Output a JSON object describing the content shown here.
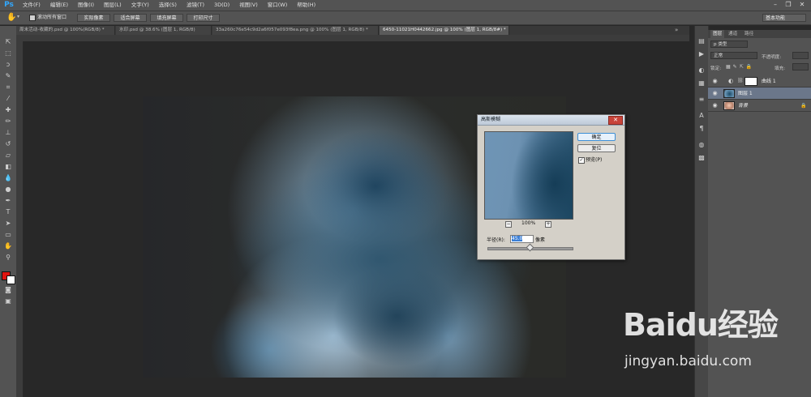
{
  "app": {
    "logo": "Ps"
  },
  "menu": [
    "文件(F)",
    "编辑(E)",
    "图像(I)",
    "图层(L)",
    "文字(Y)",
    "选择(S)",
    "滤镜(T)",
    "3D(D)",
    "视图(V)",
    "窗口(W)",
    "帮助(H)"
  ],
  "window_controls": {
    "minimize": "–",
    "restore": "❐",
    "close": "✕"
  },
  "options": {
    "scroll_all": "滚动所有窗口",
    "actual_pixels": "实际像素",
    "fit_screen": "适合屏幕",
    "fill_screen": "填充屏幕",
    "print_size": "打印尺寸",
    "workspace": "基本功能"
  },
  "tabs": [
    {
      "label": "周末活动-收藏的.psd @ 100%(RGB/8) *"
    },
    {
      "label": "水印.psd @ 38.6% (图层 1, RGB/8)"
    },
    {
      "label": "33a260c76e54c9d2a6f057e093f8ea.png @ 100% (图层 1, RGB/8) *"
    },
    {
      "label": "6450-11021H0442662.jpg @ 100% (图层 1, RGB/8#) *"
    }
  ],
  "dialog": {
    "title": "高斯模糊",
    "ok": "确定",
    "reset": "复位",
    "preview_label": "预览(P)",
    "zoom": "100%",
    "zoom_out": "−",
    "zoom_in": "+",
    "radius_label": "半径(R):",
    "radius_value": "45.0",
    "unit": "像素",
    "close": "✕"
  },
  "panel": {
    "tabs": [
      "图层",
      "通道",
      "路径"
    ],
    "kind_filter": "p 类型",
    "blend_mode": "正常",
    "opacity_label": "不透明度:",
    "lock_label": "锁定:",
    "fill_label": "填充:",
    "layers": [
      {
        "name": "曲线 1",
        "selected": false
      },
      {
        "name": "图层 1",
        "selected": true
      },
      {
        "name": "背景",
        "selected": false
      }
    ]
  },
  "watermark": {
    "logo": "Baidu经验",
    "url": "jingyan.baidu.com"
  },
  "colors": {
    "foreground": "#e0140f",
    "background": "#ffffff",
    "accent": "#31a8ff"
  }
}
